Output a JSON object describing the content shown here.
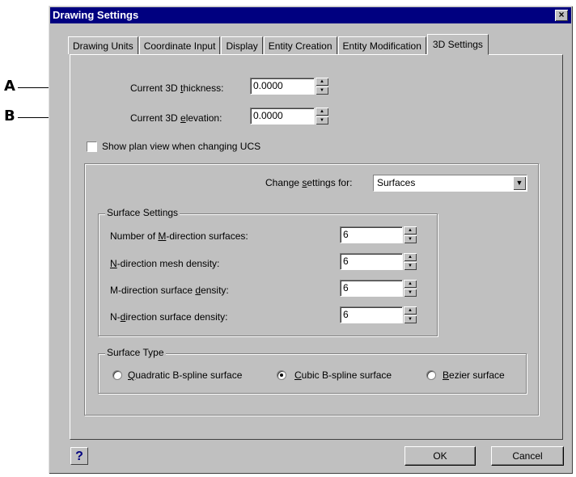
{
  "callouts": {
    "a": "A",
    "b": "B"
  },
  "window": {
    "title": "Drawing Settings",
    "close_glyph": "×"
  },
  "tabs": [
    {
      "label": "Drawing Units"
    },
    {
      "label": "Coordinate Input"
    },
    {
      "label": "Display"
    },
    {
      "label": "Entity Creation"
    },
    {
      "label": "Entity Modification"
    },
    {
      "label": "3D Settings",
      "active": true
    }
  ],
  "thickness": {
    "label_pre": "Current 3D ",
    "label_mn": "t",
    "label_post": "hickness:",
    "value": "0.0000"
  },
  "elevation": {
    "label_pre": "Current 3D ",
    "label_mn": "e",
    "label_post": "levation:",
    "value": "0.0000"
  },
  "plan_view": {
    "label": "Show plan view when changing UCS",
    "checked": false
  },
  "change_settings": {
    "label_pre": "Change ",
    "label_mn": "s",
    "label_post": "ettings for:",
    "value": "Surfaces"
  },
  "surface_settings": {
    "title": "Surface Settings",
    "m_surfaces": {
      "pre": "Number of ",
      "mn": "M",
      "post": "-direction surfaces:",
      "value": "6"
    },
    "n_mesh": {
      "pre": "",
      "mn": "N",
      "post": "-direction mesh density:",
      "value": "6"
    },
    "m_density": {
      "pre": "M-direction surface ",
      "mn": "d",
      "post": "ensity:",
      "value": "6"
    },
    "n_density": {
      "pre": "N-",
      "mn": "d",
      "post": "irection surface density:",
      "value": "6"
    }
  },
  "surface_type": {
    "title": "Surface Type",
    "quadratic": {
      "mn": "Q",
      "post": "uadratic B-spline surface",
      "checked": false
    },
    "cubic": {
      "mn": "C",
      "post": "ubic B-spline surface",
      "checked": true
    },
    "bezier": {
      "mn": "B",
      "post": "ezier surface",
      "checked": false
    }
  },
  "buttons": {
    "help": "?",
    "ok": "OK",
    "cancel": "Cancel"
  }
}
